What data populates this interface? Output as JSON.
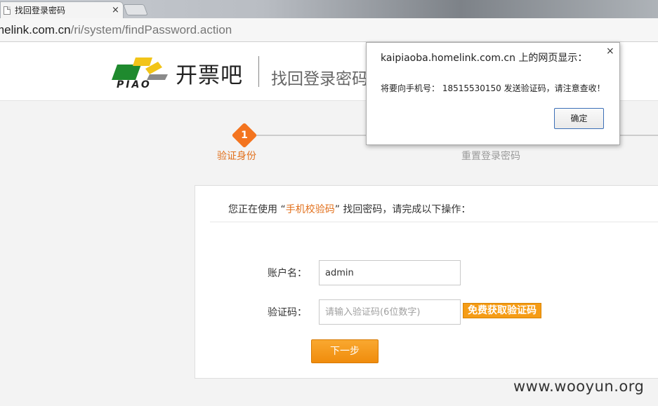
{
  "browser": {
    "tab_title": "找回登录密码",
    "tab_close": "×",
    "url_host": "melink.com.cn",
    "url_path": "/ri/system/findPassword.action"
  },
  "header": {
    "logo_text": "PIAO",
    "brand": "开票吧",
    "page_heading": "找回登录密码"
  },
  "steps": [
    {
      "number": "1",
      "label": "验证身份",
      "active": true
    },
    {
      "label": "重置登录密码",
      "active": false
    }
  ],
  "form": {
    "notice_prefix": "您正在使用 “",
    "notice_method": "手机校验码",
    "notice_suffix": "” 找回密码，请完成以下操作：",
    "account_label": "账户名：",
    "account_value": "admin",
    "code_label": "验证码：",
    "code_placeholder": "请输入验证码(6位数字)",
    "get_code_button": "免费获取验证码",
    "next_button": "下一步"
  },
  "dialog": {
    "title": "kaipiaoba.homelink.com.cn 上的网页显示：",
    "close": "×",
    "message": "将要向手机号： 18515530150  发送验证码，请注意查收！",
    "ok_button": "确定"
  },
  "watermark": "www.wooyun.org",
  "colors": {
    "accent_orange": "#f3741f",
    "button_orange": "#f59c16",
    "logo_green": "#1f8a2e",
    "logo_yellow": "#f2c418"
  }
}
